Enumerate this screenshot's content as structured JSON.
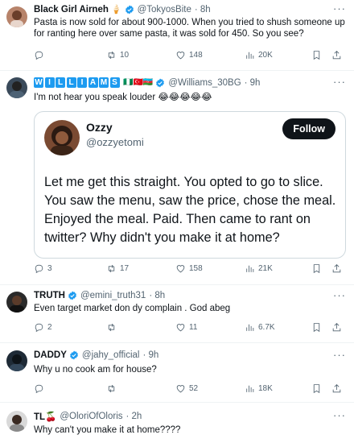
{
  "tweets": [
    {
      "name": "Black Girl Airneh",
      "handle": "@TokyosBite",
      "time": "· 8h",
      "text": "Pasta is now sold for about 900-1000. When you tried to shush someone up for ranting here over same pasta, it was sold for 450.  So you see?",
      "reply_count": "",
      "retweet_count": "10",
      "like_count": "148",
      "view_count": "20K"
    },
    {
      "name_letters": [
        "W",
        "I",
        "L",
        "L",
        "I",
        "A",
        "M",
        "S"
      ],
      "flags": "🇳🇬🇹🇷🇦🇿",
      "handle": "@Williams_30BG",
      "time": "· 9h",
      "text": "I'm not hear you speak louder 😂😂😂😂😂",
      "reply_count": "3",
      "retweet_count": "17",
      "like_count": "158",
      "view_count": "21K",
      "quote": {
        "name": "Ozzy",
        "handle": "@ozzyetomi",
        "follow_label": "Follow",
        "text": "Let me get this straight. You opted to go to slice. You saw the menu, saw the price, chose the meal. Enjoyed the meal. Paid. Then came to rant on twitter? Why didn't you make it at home?"
      }
    },
    {
      "name": "TRUTH",
      "handle": "@emini_truth31",
      "time": "· 8h",
      "text": "Even target market don dy complain . God abeg",
      "reply_count": "2",
      "retweet_count": "",
      "like_count": "11",
      "view_count": "6.7K"
    },
    {
      "name": "DADDY",
      "handle": "@jahy_official",
      "time": "· 9h",
      "text": "Why u no cook am for house?",
      "reply_count": "",
      "retweet_count": "",
      "like_count": "52",
      "view_count": "18K"
    },
    {
      "name": "TL🍒",
      "handle": "@OloriOfOloris",
      "time": "· 2h",
      "text": "Why can't you make it at home????"
    }
  ],
  "more_label": "···",
  "colors": {
    "verified": "#1d9bf0",
    "text": "#0f1419",
    "secondary": "#536471"
  }
}
